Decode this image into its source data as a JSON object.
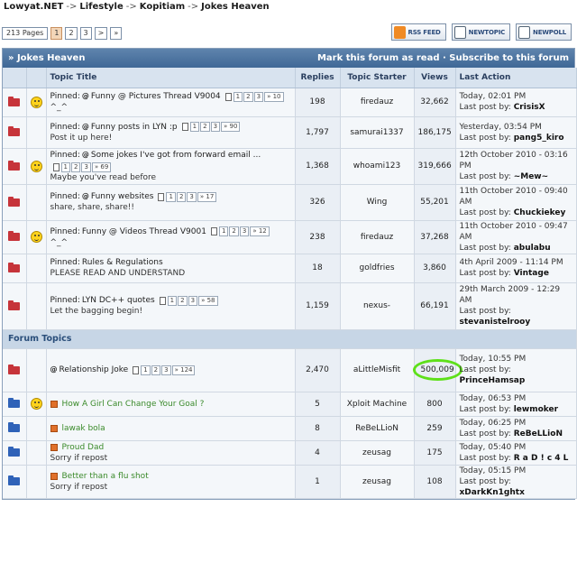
{
  "breadcrumb": [
    {
      "label": "Lowyat.NET"
    },
    {
      "label": "Lifestyle"
    },
    {
      "label": "Kopitiam"
    },
    {
      "label": "Jokes Heaven"
    }
  ],
  "breadcrumb_sep": "->",
  "pager": {
    "total_label": "213 Pages",
    "pages": [
      "1",
      "2",
      "3"
    ],
    "current": "1",
    "next": ">",
    "last": "»"
  },
  "buttons": {
    "rss": "RSS FEED",
    "newtopic": "NEWTOPIC",
    "newpoll": "NEWPOLL"
  },
  "forum": {
    "title": "» Jokes Heaven",
    "mark_read": "Mark this forum as read",
    "link_sep": "·",
    "subscribe": "Subscribe to this forum"
  },
  "columns": {
    "title": "Topic Title",
    "replies": "Replies",
    "starter": "Topic Starter",
    "views": "Views",
    "last": "Last Action"
  },
  "pinned": [
    {
      "smiley": true,
      "title": "Pinned: ",
      "link": "Funny @ Pictures Thread V9004",
      "poll": "@",
      "pages": [
        "1",
        "2",
        "3",
        "» 10"
      ],
      "desc": "^_^",
      "replies": "198",
      "starter": "firedauz",
      "views": "32,662",
      "last_date": "Today, 02:01 PM",
      "last_by": "Last post by:",
      "last_user": "CrisisX"
    },
    {
      "smiley": false,
      "title": "Pinned: ",
      "link": "Funny posts in LYN :p",
      "poll": "@",
      "pages": [
        "1",
        "2",
        "3",
        "» 90"
      ],
      "desc": "Post it up here!",
      "replies": "1,797",
      "starter": "samurai1337",
      "views": "186,175",
      "last_date": "Yesterday, 03:54 PM",
      "last_by": "Last post by:",
      "last_user": "pang5_kiro"
    },
    {
      "smiley": true,
      "title": "Pinned: ",
      "link": "Some jokes I've got from forward email ...",
      "poll": "@",
      "pages": [
        "1",
        "2",
        "3",
        "» 69"
      ],
      "desc": "Maybe you've read before",
      "replies": "1,368",
      "starter": "whoami123",
      "views": "319,666",
      "last_date": "12th October 2010 - 03:16 PM",
      "last_by": "Last post by:",
      "last_user": "~Mew~"
    },
    {
      "smiley": false,
      "title": "Pinned: ",
      "link": "Funny websites",
      "poll": "@",
      "pages": [
        "1",
        "2",
        "3",
        "» 17"
      ],
      "desc": "share, share, share!!",
      "replies": "326",
      "starter": "Wing",
      "views": "55,201",
      "last_date": "11th October 2010 - 09:40 AM",
      "last_by": "Last post by:",
      "last_user": "Chuckiekey"
    },
    {
      "smiley": true,
      "title": "Pinned: ",
      "link": "Funny @ Videos Thread V9001",
      "poll": "",
      "pages": [
        "1",
        "2",
        "3",
        "» 12"
      ],
      "desc": "^_^",
      "replies": "238",
      "starter": "firedauz",
      "views": "37,268",
      "last_date": "11th October 2010 - 09:47 AM",
      "last_by": "Last post by:",
      "last_user": "abulabu"
    },
    {
      "smiley": false,
      "title": "Pinned: ",
      "link": "Rules & Regulations",
      "poll": "",
      "pages": [],
      "desc": "PLEASE READ AND UNDERSTAND",
      "replies": "18",
      "starter": "goldfries",
      "views": "3,860",
      "last_date": "4th April 2009 - 11:14 PM",
      "last_by": "Last post by:",
      "last_user": "Vintage"
    },
    {
      "smiley": false,
      "title": "Pinned: ",
      "link": "LYN DC++ quotes",
      "poll": "",
      "pages": [
        "1",
        "2",
        "3",
        "» 58"
      ],
      "desc": "Let the bagging begin!",
      "replies": "1,159",
      "starter": "nexus-",
      "views": "66,191",
      "last_date": "29th March 2009 - 12:29 AM",
      "last_by": "Last post by:",
      "last_user": "stevanistelrooy"
    }
  ],
  "section_label": "Forum Topics",
  "topics": [
    {
      "folder": "red",
      "smiley": false,
      "icon": "poll",
      "link": "Relationship Joke",
      "poll": "@",
      "pages": [
        "1",
        "2",
        "3",
        "» 124"
      ],
      "desc": "",
      "replies": "2,470",
      "starter": "aLittleMisfit",
      "views": "500,009",
      "highlight": true,
      "last_date": "Today, 10:55 PM",
      "last_by": "Last post by:",
      "last_user": "PrinceHamsap"
    },
    {
      "folder": "blue",
      "smiley": true,
      "icon": "topic",
      "link": "How A Girl Can Change Your Goal ?",
      "poll": "",
      "pages": [],
      "desc": "",
      "replies": "5",
      "starter": "Xploit Machine",
      "views": "800",
      "highlight": false,
      "last_date": "Today, 06:53 PM",
      "last_by": "Last post by:",
      "last_user": "lewmoker"
    },
    {
      "folder": "blue",
      "smiley": false,
      "icon": "topic",
      "link": "lawak bola",
      "poll": "",
      "pages": [],
      "desc": "",
      "replies": "8",
      "starter": "ReBeLLioN",
      "views": "259",
      "highlight": false,
      "last_date": "Today, 06:25 PM",
      "last_by": "Last post by:",
      "last_user": "ReBeLLioN"
    },
    {
      "folder": "blue",
      "smiley": false,
      "icon": "topic",
      "link": "Proud Dad",
      "poll": "",
      "pages": [],
      "desc": "Sorry if repost",
      "replies": "4",
      "starter": "zeusag",
      "views": "175",
      "highlight": false,
      "last_date": "Today, 05:40 PM",
      "last_by": "Last post by:",
      "last_user": "R a D ! c 4 L"
    },
    {
      "folder": "blue",
      "smiley": false,
      "icon": "topic",
      "link": "Better than a flu shot",
      "poll": "",
      "pages": [],
      "desc": "Sorry if repost",
      "replies": "1",
      "starter": "zeusag",
      "views": "108",
      "highlight": false,
      "last_date": "Today, 05:15 PM",
      "last_by": "Last post by:",
      "last_user": "xDarkKn1ghtx"
    }
  ]
}
